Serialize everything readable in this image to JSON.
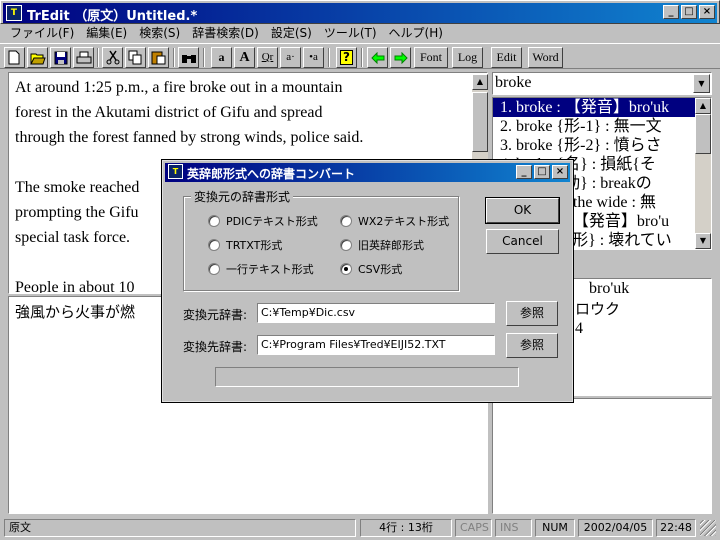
{
  "window": {
    "title": "TrEdit （原文）Untitled.*",
    "icon": "T",
    "buttons": [
      "_",
      "□",
      "×"
    ]
  },
  "menu": [
    "ファイル(F)",
    "編集(E)",
    "検索(S)",
    "辞書検索(D)",
    "設定(S)",
    "ツール(T)",
    "ヘルプ(H)"
  ],
  "toolbar": {
    "font_label": "Font",
    "log_label": "Log",
    "edit_label": "Edit",
    "word_label": "Word",
    "icons": [
      "new-icon",
      "open-icon",
      "save-icon",
      "print-icon",
      "cut-icon",
      "copy-icon",
      "paste-icon",
      "find-icon",
      "font-small-icon",
      "font-large-icon",
      "ruby-icon",
      "accent-icon",
      "mark-icon",
      "help-icon",
      "back-arrow-icon",
      "forward-arrow-icon"
    ]
  },
  "editor": {
    "lines": [
      "At around 1:25 p.m., a fire broke out in a mountain",
      "forest in the Akutami district of Gifu and spread",
      "through the forest fanned by strong winds, police said.",
      "",
      "The smoke reached",
      "prompting the Gifu",
      "special task force.",
      "",
      "People in about 10"
    ]
  },
  "translation": {
    "line": "強風から火事が燃"
  },
  "dictionary": {
    "search_value": "broke",
    "results": [
      "1. broke : 【発音】bro'uk",
      "2. broke {形-1} : 無一文",
      "3. broke {形-2} : 憤らさ",
      "4. broke {名} : 損紙{そ",
      "5. broke {動} : breakの",
      "6. broke to the wide : 無",
      "7. broken : 【発音】bro'u",
      "8. broken {形} : 壊れてい"
    ],
    "detail_lines": [
      "bro'uk",
      "ロウク",
      "4"
    ]
  },
  "dialog": {
    "title": "英辞郎形式への辞書コンバート",
    "group_label": "変換元の辞書形式",
    "options": [
      {
        "label": "PDICテキスト形式",
        "selected": false
      },
      {
        "label": "WX2テキスト形式",
        "selected": false
      },
      {
        "label": "TRTXT形式",
        "selected": false
      },
      {
        "label": "旧英辞郎形式",
        "selected": false
      },
      {
        "label": "一行テキスト形式",
        "selected": false
      },
      {
        "label": "CSV形式",
        "selected": true
      }
    ],
    "ok_label": "OK",
    "cancel_label": "Cancel",
    "source_label": "変換元辞書:",
    "source_value": "C:¥Temp¥Dic.csv",
    "dest_label": "変換先辞書:",
    "dest_value": "C:¥Program Files¥Tred¥EIJI52.TXT",
    "browse_label": "参照",
    "progress": 0
  },
  "status": {
    "mode": "原文",
    "position": "4行 : 13桁",
    "caps": "CAPS",
    "ins": "INS",
    "num": "NUM",
    "date": "2002/04/05",
    "time": "22:48"
  }
}
